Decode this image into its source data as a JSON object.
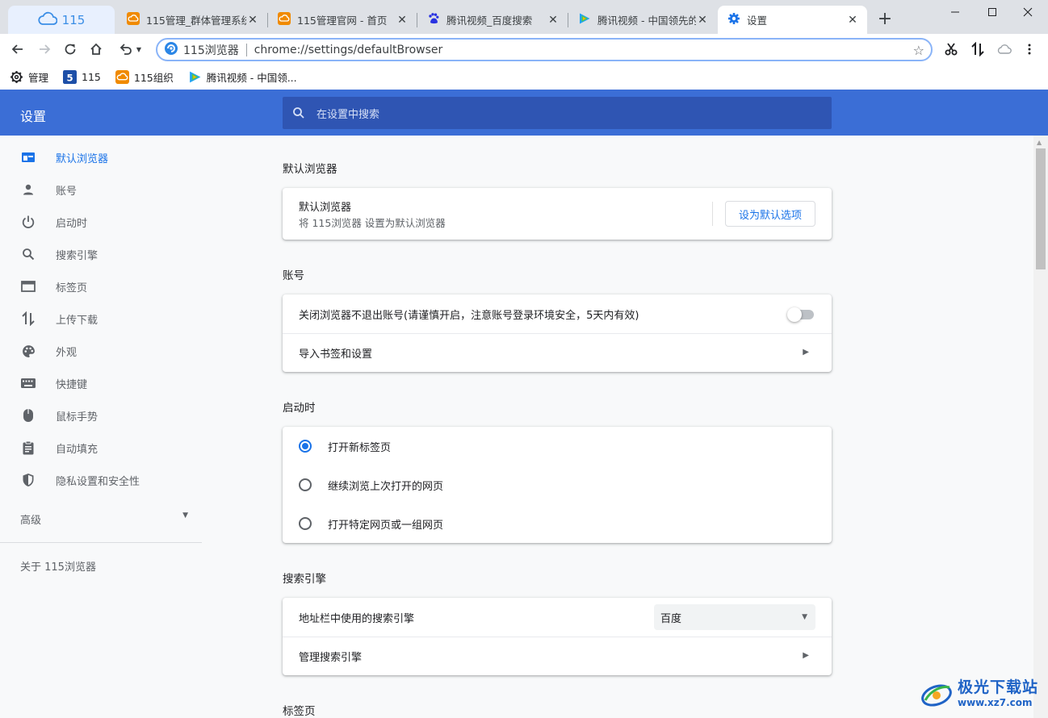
{
  "tabs": [
    {
      "label": "115管理_群体管理系统",
      "icon": "cloud-orange-icon"
    },
    {
      "label": "115管理官网 - 首页",
      "icon": "cloud-orange-icon"
    },
    {
      "label": "腾讯视频_百度搜索",
      "icon": "baidu-paw-icon"
    },
    {
      "label": "腾讯视频 - 中国领先的",
      "icon": "tencent-video-icon"
    },
    {
      "label": "设置",
      "icon": "gear-icon"
    }
  ],
  "home_tab": {
    "label": "115"
  },
  "omnibox": {
    "browser_name": "115浏览器",
    "url": "chrome://settings/defaultBrowser"
  },
  "bookmarks": [
    {
      "label": "管理",
      "icon": "gear-icon"
    },
    {
      "label": "115",
      "icon": "115-logo-icon"
    },
    {
      "label": "115组织",
      "icon": "cloud-orange-icon"
    },
    {
      "label": "腾讯视频 - 中国领...",
      "icon": "tencent-video-icon"
    }
  ],
  "header": {
    "title": "设置",
    "search_placeholder": "在设置中搜索"
  },
  "sidebar": {
    "items": [
      {
        "label": "默认浏览器",
        "icon": "browser-window-icon"
      },
      {
        "label": "账号",
        "icon": "person-icon"
      },
      {
        "label": "启动时",
        "icon": "power-icon"
      },
      {
        "label": "搜索引擎",
        "icon": "search-icon"
      },
      {
        "label": "标签页",
        "icon": "tab-icon"
      },
      {
        "label": "上传下载",
        "icon": "upload-download-icon"
      },
      {
        "label": "外观",
        "icon": "palette-icon"
      },
      {
        "label": "快捷键",
        "icon": "keyboard-icon"
      },
      {
        "label": "鼠标手势",
        "icon": "mouse-icon"
      },
      {
        "label": "自动填充",
        "icon": "clipboard-icon"
      },
      {
        "label": "隐私设置和安全性",
        "icon": "shield-icon"
      }
    ],
    "advanced": "高级",
    "about": "关于 115浏览器"
  },
  "sections": {
    "default_browser": {
      "title": "默认浏览器",
      "row_title": "默认浏览器",
      "row_sub": "将 115浏览器 设置为默认浏览器",
      "button": "设为默认选项"
    },
    "account": {
      "title": "账号",
      "keep_login": "关闭浏览器不退出账号(请谨慎开启，注意账号登录环境安全，5天内有效)",
      "keep_login_on": false,
      "import": "导入书签和设置"
    },
    "startup": {
      "title": "启动时",
      "options": [
        "打开新标签页",
        "继续浏览上次打开的网页",
        "打开特定网页或一组网页"
      ],
      "selected": 0
    },
    "search_engine": {
      "title": "搜索引擎",
      "address_bar_label": "地址栏中使用的搜索引擎",
      "engine_value": "百度",
      "manage": "管理搜索引擎"
    },
    "tabs": {
      "title": "标签页"
    }
  },
  "watermark": {
    "title": "极光下载站",
    "url": "www.xz7.com"
  },
  "colors": {
    "accent": "#1a73e8",
    "header": "#3b6ed6"
  }
}
